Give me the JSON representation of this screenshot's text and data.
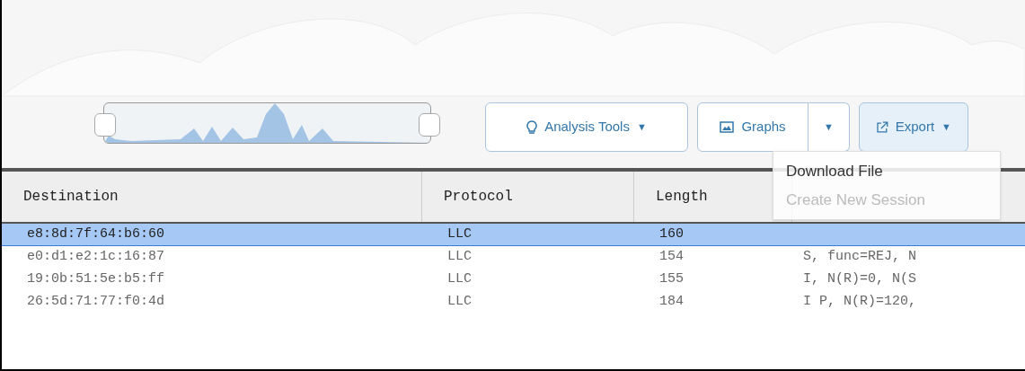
{
  "toolbar": {
    "buttons": [
      {
        "kind": "analysis",
        "label": "Analysis Tools",
        "caret": "▼"
      },
      {
        "kind": "graphs",
        "label": "Graphs",
        "caret": "▼"
      },
      {
        "kind": "export",
        "label": "Export",
        "caret": "▼"
      }
    ]
  },
  "export_menu": {
    "items": [
      {
        "label": "Download File",
        "disabled": false
      },
      {
        "label": "Create New Session",
        "disabled": true
      }
    ]
  },
  "table": {
    "columns": [
      "Destination",
      "Protocol",
      "Length"
    ],
    "rows": [
      {
        "cells": [
          "e8:8d:7f:64:b6:60",
          "LLC",
          "160",
          ""
        ],
        "selected": true
      },
      {
        "cells": [
          "e0:d1:e2:1c:16:87",
          "LLC",
          "154",
          "S, func=REJ, N"
        ],
        "selected": false
      },
      {
        "cells": [
          "19:0b:51:5e:b5:ff",
          "LLC",
          "155",
          "I, N(R)=0, N(S"
        ],
        "selected": false
      },
      {
        "cells": [
          "26:5d:71:77:f0:4d",
          "LLC",
          "184",
          "I P, N(R)=120,"
        ],
        "selected": false
      }
    ]
  }
}
